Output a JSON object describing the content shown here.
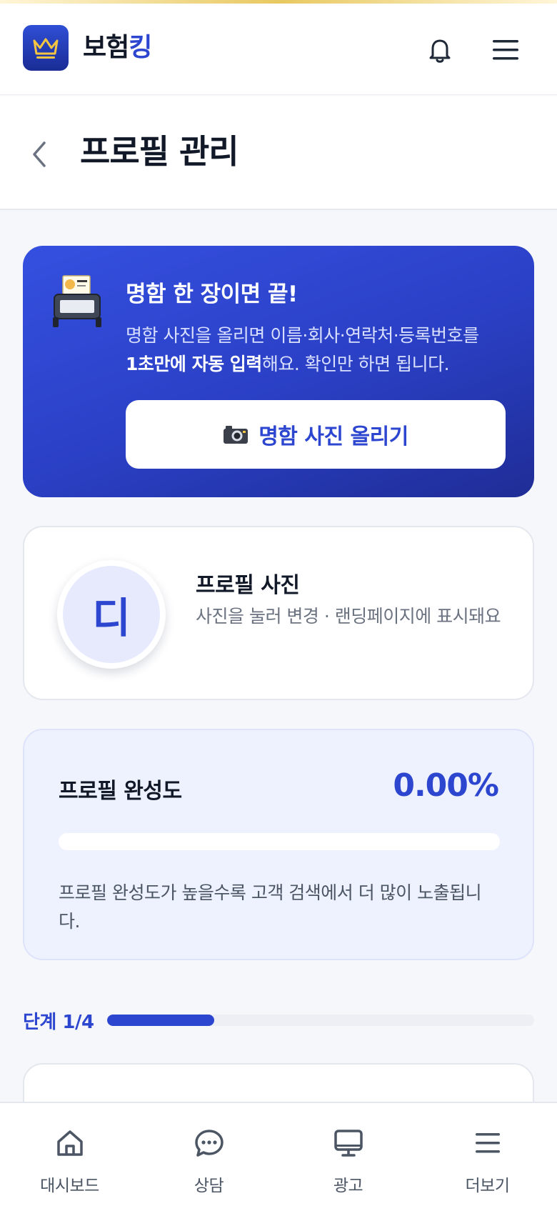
{
  "app": {
    "brand_part1": "보험",
    "brand_part2": "킹",
    "accent_color": "#2d46d0",
    "header_icons": [
      "crown-logo-icon",
      "bell-icon",
      "hamburger-menu-icon"
    ]
  },
  "page": {
    "title": "프로필 관리",
    "back_icon": "chevron-left-icon"
  },
  "promo": {
    "icon": "scanner-icon",
    "title": "명함 한 장이면 끝!",
    "desc_line1": "명함 사진을 올리면 이름·회사·연락처·등록번호를",
    "desc_bold": "1초만에 자동 입력",
    "desc_tail": "해요. 확인만 하면 됩니다.",
    "button_icon": "camera-icon",
    "button_label": "명함 사진 올리기"
  },
  "profile_photo": {
    "avatar_initial": "디",
    "title": "프로필 사진",
    "desc": "사진을 눌러 변경 · 랜딩페이지에 표시돼요"
  },
  "completion": {
    "label": "프로필 완성도",
    "value_text": "0.00%",
    "progress_percent": 0,
    "desc": "프로필 완성도가 높을수록 고객 검색에서 더 많이 노출됩니다."
  },
  "step": {
    "label": "단계 1/4",
    "current": 1,
    "total": 4
  },
  "bottom_nav": {
    "items": [
      {
        "label": "대시보드",
        "icon": "home-icon"
      },
      {
        "label": "상담",
        "icon": "chat-bubble-icon"
      },
      {
        "label": "광고",
        "icon": "monitor-icon"
      },
      {
        "label": "더보기",
        "icon": "menu-icon"
      }
    ]
  }
}
